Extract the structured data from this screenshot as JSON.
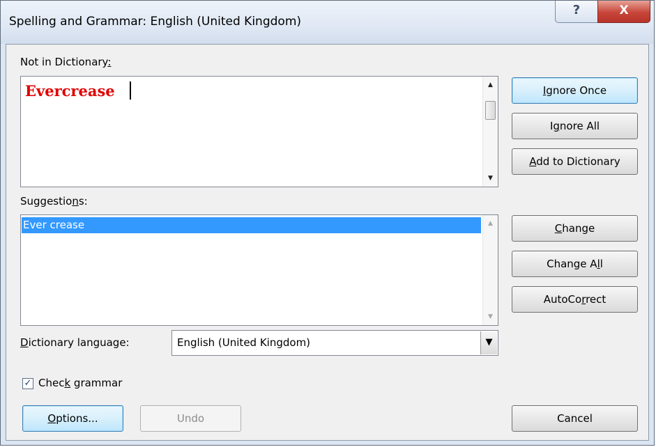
{
  "window": {
    "title": "Spelling and Grammar: English (United Kingdom)",
    "help_glyph": "?",
    "close_glyph": "X"
  },
  "not_in_dictionary": {
    "label_main": "Not in Dictionary",
    "label_accel": ":",
    "text": "Evercrease",
    "error_color": "#e00000"
  },
  "suggestions": {
    "label_pre": "Suggestio",
    "label_accel": "n",
    "label_post": "s:",
    "items": [
      "Ever crease"
    ],
    "selected_index": 0
  },
  "language": {
    "label_accel": "D",
    "label_rest": "ictionary language:",
    "value": "English (United Kingdom)"
  },
  "check_grammar": {
    "label_pre": "Chec",
    "label_accel": "k",
    "label_post": " grammar",
    "checked": true
  },
  "buttons": {
    "ignore_once": {
      "accel": "I",
      "rest": "gnore Once"
    },
    "ignore_all": {
      "pre": "I",
      "accel": "g",
      "rest": "nore All"
    },
    "add_dictionary": {
      "accel": "A",
      "rest": "dd to Dictionary"
    },
    "change": {
      "accel": "C",
      "rest": "hange"
    },
    "change_all": {
      "pre": "Change A",
      "accel": "l",
      "rest": "l"
    },
    "autocorrect": {
      "pre": "AutoCo",
      "accel": "r",
      "rest": "rect"
    },
    "options": {
      "accel": "O",
      "rest": "ptions..."
    },
    "undo": "Undo",
    "cancel": "Cancel"
  },
  "icons": {
    "scroll_up": "▲",
    "scroll_down": "▼",
    "dropdown": "▼",
    "check": "✓"
  }
}
